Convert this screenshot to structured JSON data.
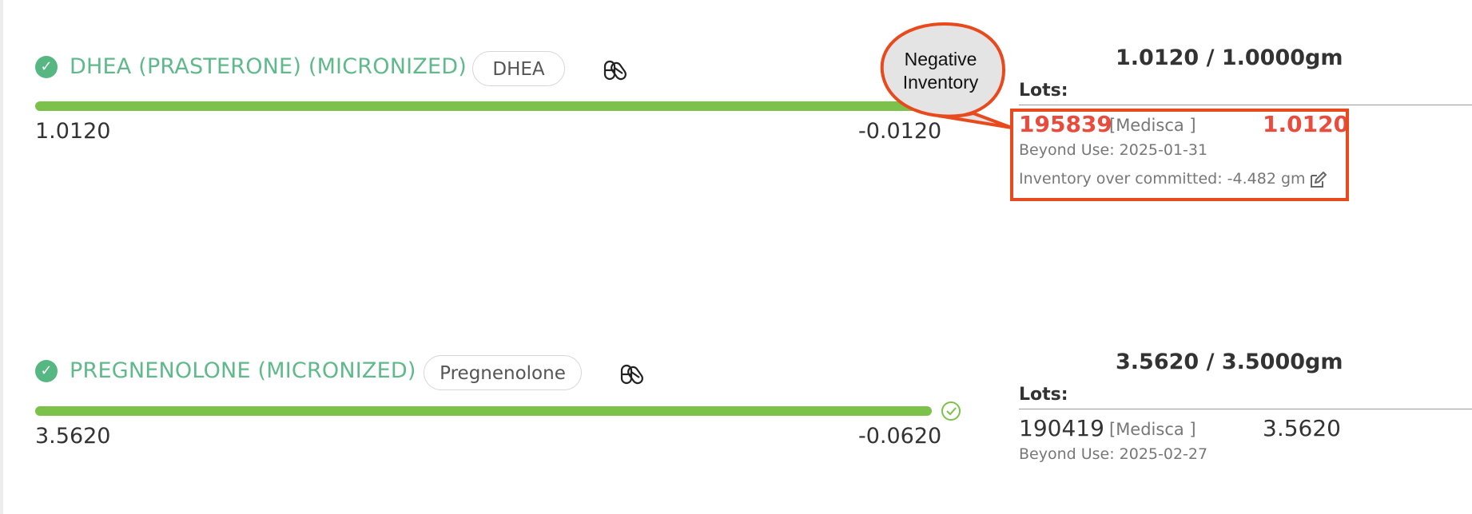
{
  "ingredients": [
    {
      "name": "DHEA (PRASTERONE) (MICRONIZED)",
      "chip": "DHEA",
      "status_icon": "check-circle-icon",
      "pill_icon": "capsule-icon",
      "bar_left_value": "1.0120",
      "bar_right_value": "-0.0120",
      "progress": 1.0,
      "totals": "1.0120 /  1.0000gm",
      "lots_label": "Lots:",
      "lot": {
        "number": "195839",
        "supplier": "[Medisca ]",
        "qty": "1.0120",
        "beyond_use": "Beyond Use: 2025-01-31",
        "note": "Inventory over committed: -4.482 gm",
        "edit_icon": "edit-icon"
      }
    },
    {
      "name": "PREGNENOLONE (MICRONIZED)",
      "chip": "Pregnenolone",
      "status_icon": "check-circle-icon",
      "pill_icon": "capsule-icon",
      "bar_left_value": "3.5620",
      "bar_right_value": "-0.0620",
      "progress": 1.0,
      "done_icon": "check-circle-outline-icon",
      "totals": "3.5620 /  3.5000gm",
      "lots_label": "Lots:",
      "lot": {
        "number": "190419",
        "supplier": "[Medisca ]",
        "qty": "3.5620",
        "beyond_use": "Beyond Use: 2025-02-27"
      }
    }
  ],
  "callout": {
    "line1": "Negative",
    "line2": "Inventory"
  },
  "colors": {
    "accent_green": "#5fb98a",
    "bar_green": "#7cc24a",
    "negative_red": "#e94b3c",
    "callout_border": "#e8491d"
  }
}
